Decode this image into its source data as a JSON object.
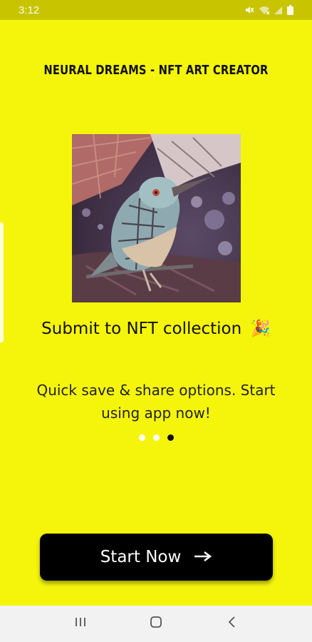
{
  "status_bar": {
    "time": "3:12",
    "icons": [
      "mute-icon",
      "wifi-icon",
      "signal-icon",
      "battery-icon"
    ]
  },
  "app": {
    "title": "NEURAL DREAMS - NFT ART CREATOR"
  },
  "onboarding": {
    "headline": "Submit to NFT collection",
    "headline_emoji": "🎉",
    "description": "Quick save & share options. Start using app now!",
    "page_count": 3,
    "active_page": 3
  },
  "cta": {
    "label": "Start Now",
    "arrow": "⟶"
  },
  "nav_bar": {
    "items": [
      "recents-icon",
      "home-icon",
      "back-icon"
    ]
  },
  "colors": {
    "background": "#f5f50c",
    "status_bar": "#c8c400",
    "button": "#000000",
    "button_text": "#ffffff"
  }
}
